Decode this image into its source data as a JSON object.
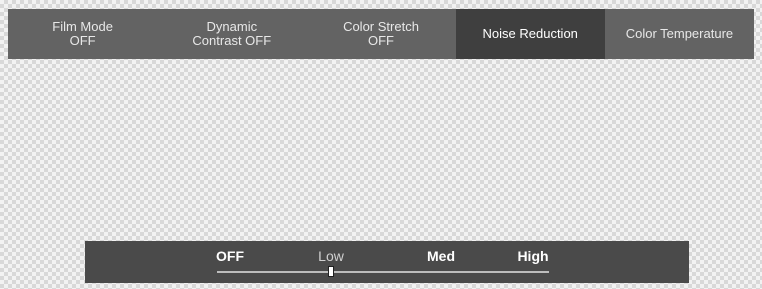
{
  "menu": {
    "items": [
      {
        "line1": "Film Mode",
        "line2": "OFF"
      },
      {
        "line1": "Dynamic",
        "line2": "Contrast OFF"
      },
      {
        "line1": "Color Stretch",
        "line2": "OFF"
      },
      {
        "line1": "Noise Reduction"
      },
      {
        "line1": "Color Temperature"
      }
    ],
    "selected_index": 3
  },
  "noise_reduction": {
    "options": [
      "OFF",
      "Low",
      "Med",
      "High"
    ],
    "current": "Low"
  },
  "colors": {
    "menu_bg": "#636363",
    "selected_bg": "#3f3f3f",
    "panel_bg": "#4a4a4a"
  }
}
